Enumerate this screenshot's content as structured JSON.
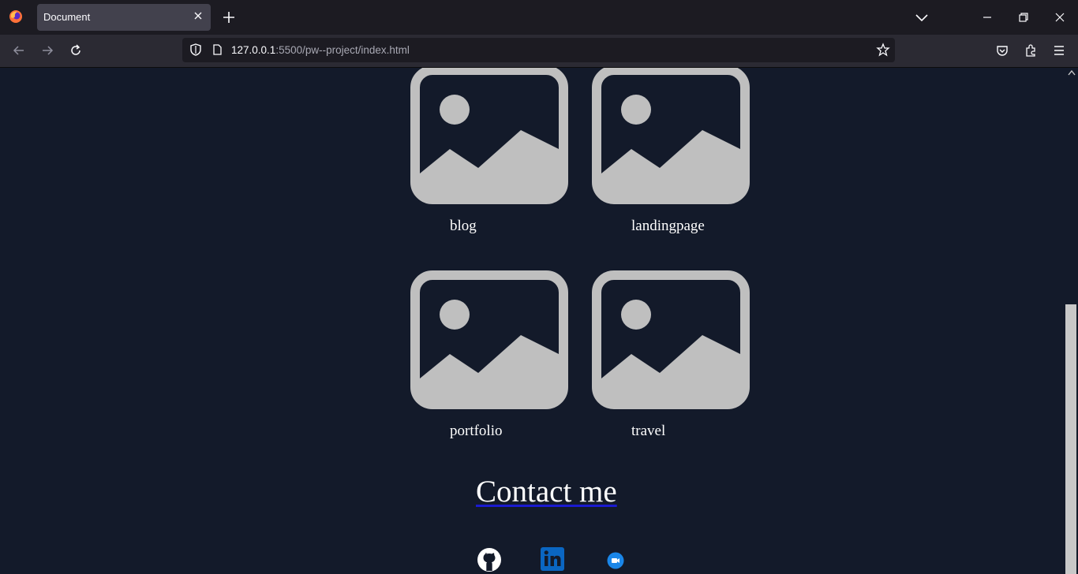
{
  "browser": {
    "tab_title": "Document",
    "url_host": "127.0.0.1",
    "url_rest": ":5500/pw--project/index.html"
  },
  "projects": [
    {
      "label": "blog"
    },
    {
      "label": "landingpage"
    },
    {
      "label": "portfolio"
    },
    {
      "label": "travel"
    }
  ],
  "contact": {
    "heading": "Contact me",
    "links": [
      {
        "icon": "github-icon"
      },
      {
        "icon": "linkedin-icon"
      },
      {
        "icon": "meet-icon"
      }
    ]
  },
  "colors": {
    "page_bg": "#131a2a",
    "placeholder": "#bfbfbf",
    "underline": "#1a1ad0"
  }
}
